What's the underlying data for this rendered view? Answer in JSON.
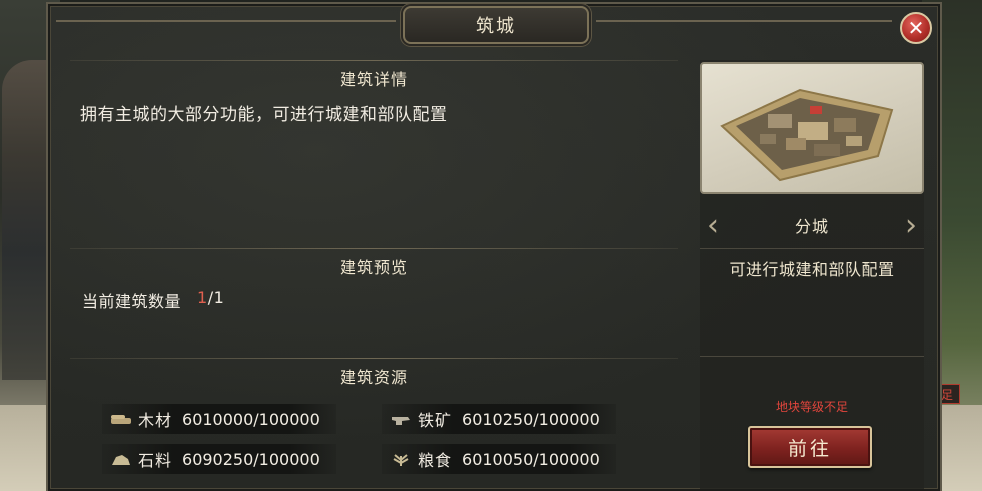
{
  "window": {
    "title": "筑城",
    "close_label": "✕"
  },
  "sections": {
    "details_title": "建筑详情",
    "details_text": "拥有主城的大部分功能，可进行城建和部队配置",
    "preview_title": "建筑预览",
    "count_label": "当前建筑数量",
    "count_current": "1",
    "count_sep_total": "/1",
    "resources_title": "建筑资源"
  },
  "resources": [
    {
      "label": "木材",
      "value": "6010000/100000",
      "icon": "wood-icon"
    },
    {
      "label": "铁矿",
      "value": "6010250/100000",
      "icon": "iron-icon"
    },
    {
      "label": "石料",
      "value": "6090250/100000",
      "icon": "stone-icon"
    },
    {
      "label": "粮食",
      "value": "6010050/100000",
      "icon": "grain-icon"
    }
  ],
  "building": {
    "name": "分城",
    "description": "可进行城建和部队配置",
    "prev_icon": "chevron-left-icon",
    "next_icon": "chevron-right-icon"
  },
  "action": {
    "warning": "地块等级不足",
    "go_label": "前往"
  },
  "background": {
    "corner_badge": "足"
  },
  "colors": {
    "accent_red": "#a43a34",
    "warning_red": "#e0453c",
    "count_red": "#e0604f",
    "gold_border": "#d8c49a"
  }
}
